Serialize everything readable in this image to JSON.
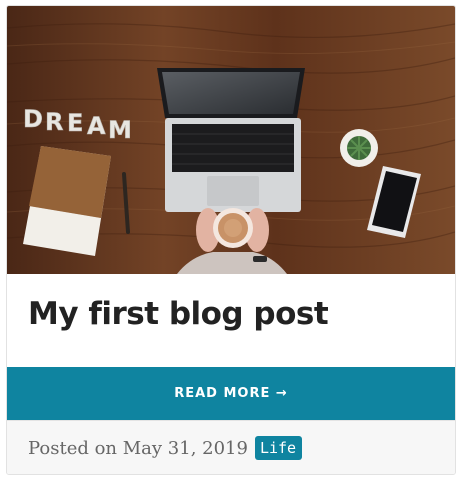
{
  "post": {
    "title": "My first blog post",
    "read_more_label": "READ MORE →",
    "posted_on": "Posted on May 31, 2019",
    "tag": "Life"
  },
  "hero_image": {
    "letters": [
      "D",
      "R",
      "E",
      "A",
      "M"
    ]
  },
  "colors": {
    "accent": "#0f84a0",
    "wood": "#6b3d22",
    "title": "#222222",
    "footer_bg": "#f7f7f7"
  }
}
